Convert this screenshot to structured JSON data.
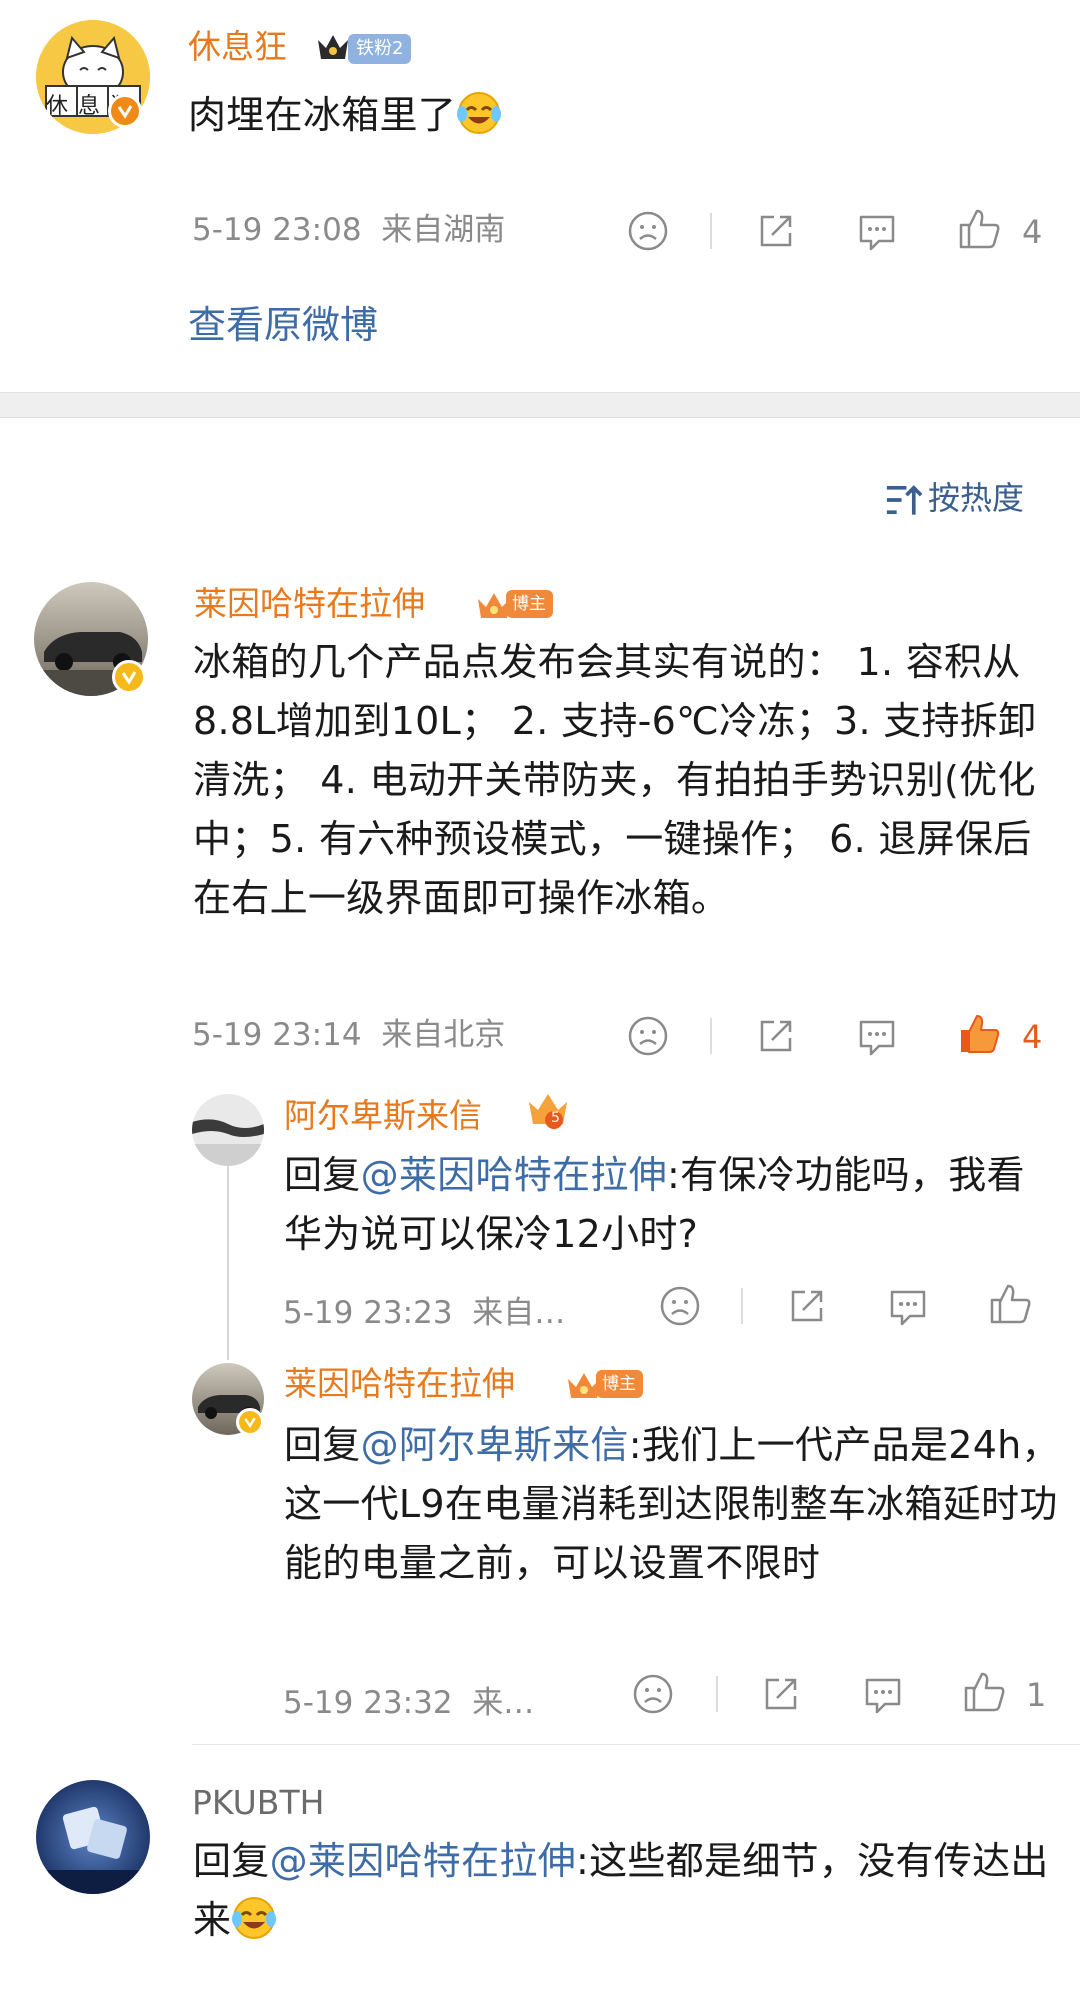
{
  "top_post": {
    "username": "休息狂",
    "fan_badge": "铁粉2",
    "content": "肉埋在冰箱里了",
    "content_emoji": "laugh-cry-emoji",
    "time": "5-19 23:08",
    "location": "来自湖南",
    "likes": "4",
    "avatar_text": "休息狂",
    "view_original": "查看原微博"
  },
  "sort_label": "按热度",
  "comments": [
    {
      "username": "莱因哈特在拉伸",
      "badge": "博主",
      "content": "冰箱的几个产品点发布会其实有说的： 1. 容积从8.8L增加到10L； 2. 支持-6℃冷冻；3. 支持拆卸清洗； 4. 电动开关带防夹，有拍拍手势识别(优化中；5. 有六种预设模式，一键操作； 6. 退屏保后在右上一级界面即可操作冰箱。",
      "time": "5-19 23:14",
      "location": "来自北京",
      "likes": "4",
      "liked": true,
      "replies": [
        {
          "username": "阿尔卑斯来信",
          "level_badge": "5",
          "reply_prefix": "回复",
          "reply_to": "@莱因哈特在拉伸",
          "content": ":有保冷功能吗，我看华为说可以保冷12小时?",
          "time": "5-19 23:23",
          "location": "来自…",
          "likes": ""
        },
        {
          "username": "莱因哈特在拉伸",
          "badge": "博主",
          "reply_prefix": "回复",
          "reply_to": "@阿尔卑斯来信",
          "content": ":我们上一代产品是24h，这一代L9在电量消耗到达限制整车冰箱延时功能的电量之前，可以设置不限时",
          "time": "5-19 23:32",
          "location": "来…",
          "likes": "1"
        }
      ]
    },
    {
      "username": "PKUBTH",
      "reply_prefix": "回复",
      "reply_to": "@莱因哈特在拉伸",
      "content": ":这些都是细节，没有传达出来",
      "content_emoji": "laugh-cry-emoji"
    }
  ],
  "colors": {
    "username": "#e8791c",
    "link": "#3e6ca6",
    "meta": "#8a8a8a",
    "liked": "#e8591c"
  }
}
